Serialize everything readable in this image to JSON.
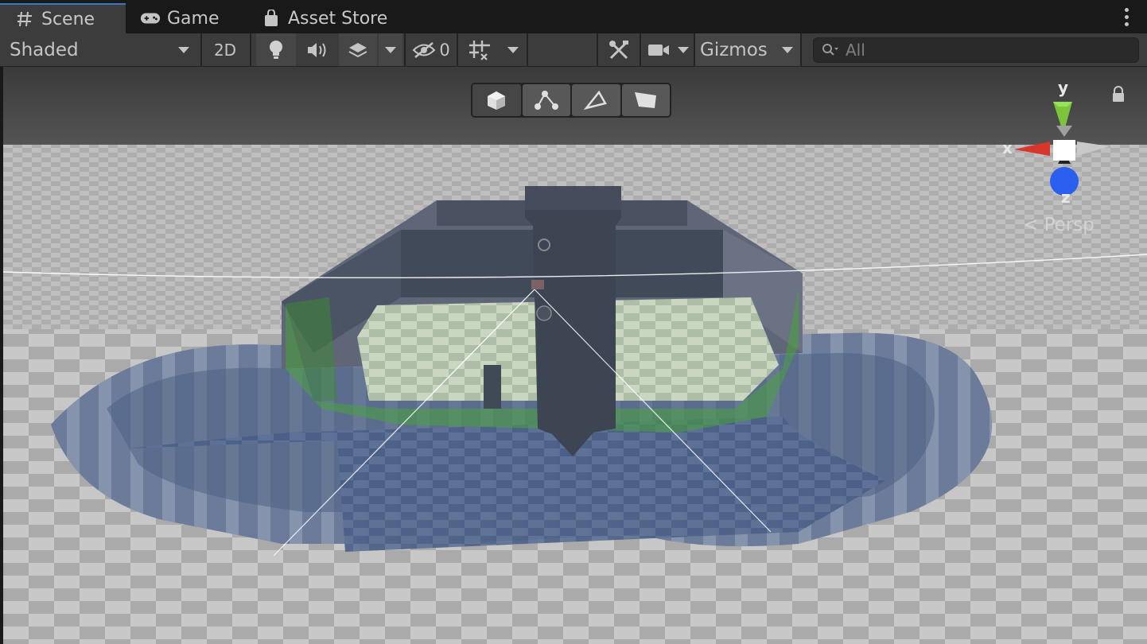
{
  "tabs": [
    {
      "label": "Scene",
      "icon": "hash-icon",
      "active": true
    },
    {
      "label": "Game",
      "icon": "gamepad-icon",
      "active": false
    },
    {
      "label": "Asset Store",
      "icon": "shopping-bag-icon",
      "active": false
    }
  ],
  "toolbar": {
    "draw_mode": "Shaded",
    "two_d_label": "2D",
    "hidden_count": "0",
    "gizmos_label": "Gizmos",
    "search_placeholder": "All"
  },
  "scene": {
    "gizmo_axes": {
      "x": "x",
      "y": "y",
      "z": "z"
    },
    "projection_label": "< Persp"
  },
  "colors": {
    "accent_tab": "#3a79bb",
    "axis_x": "#d8352b",
    "axis_y": "#7cc43a",
    "axis_z": "#2a5ff0",
    "panel": "#3c3c3c"
  }
}
